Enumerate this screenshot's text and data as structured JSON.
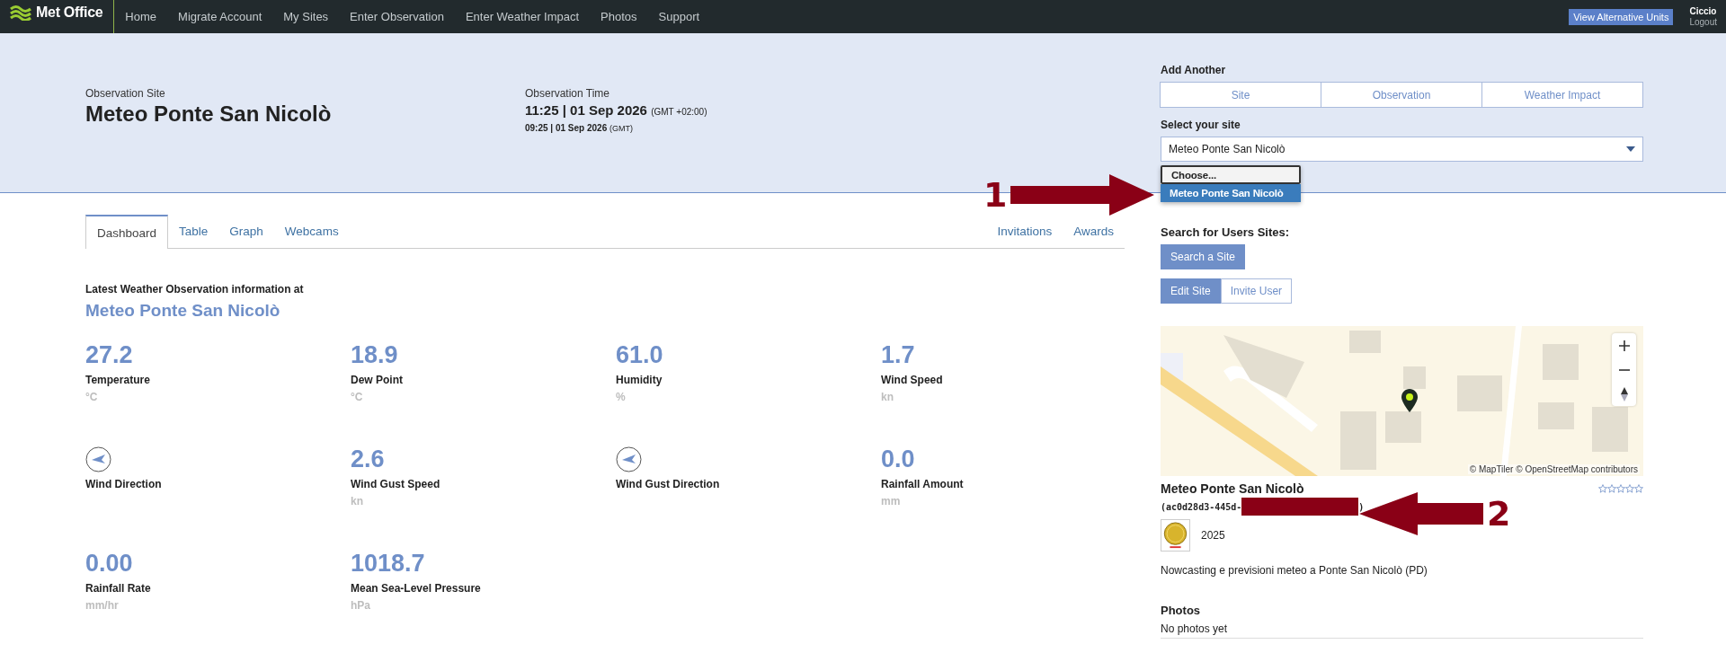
{
  "nav": {
    "logo": "Met Office",
    "links": [
      {
        "label": "Home"
      },
      {
        "label": "Migrate Account"
      },
      {
        "label": "My Sites"
      },
      {
        "label": "Enter Observation"
      },
      {
        "label": "Enter Weather Impact"
      },
      {
        "label": "Photos"
      },
      {
        "label": "Support"
      }
    ],
    "alt_units_button": "View Alternative Units",
    "user": "Ciccio",
    "logout": "Logout"
  },
  "header": {
    "site_label": "Observation Site",
    "site_name": "Meteo Ponte San Nicolò",
    "time_label": "Observation Time",
    "local_time": "11:25 | 01 Sep 2026",
    "local_zone": "(GMT +02:00)",
    "gmt_time": "09:25 | 01 Sep 2026",
    "gmt_zone": "(GMT)"
  },
  "tabs": [
    {
      "label": "Dashboard",
      "selected": true
    },
    {
      "label": "Table",
      "selected": false
    },
    {
      "label": "Graph",
      "selected": false
    },
    {
      "label": "Webcams",
      "selected": false
    }
  ],
  "side_tabs": [
    "Invitations",
    "Awards"
  ],
  "latest": {
    "heading": "Latest Weather Observation information at",
    "site": "Meteo Ponte San Nicolò"
  },
  "metrics": [
    {
      "kind": "value",
      "value": "27.2",
      "label": "Temperature",
      "unit": "°C"
    },
    {
      "kind": "value",
      "value": "18.9",
      "label": "Dew Point",
      "unit": "°C"
    },
    {
      "kind": "value",
      "value": "61.0",
      "label": "Humidity",
      "unit": "%"
    },
    {
      "kind": "value",
      "value": "1.7",
      "label": "Wind Speed",
      "unit": "kn"
    },
    {
      "kind": "direction",
      "label": "Wind Direction"
    },
    {
      "kind": "value",
      "value": "2.6",
      "label": "Wind Gust Speed",
      "unit": "kn"
    },
    {
      "kind": "direction",
      "label": "Wind Gust Direction"
    },
    {
      "kind": "value",
      "value": "0.0",
      "label": "Rainfall Amount",
      "unit": "mm"
    },
    {
      "kind": "value",
      "value": "0.00",
      "label": "Rainfall Rate",
      "unit": "mm/hr"
    },
    {
      "kind": "value",
      "value": "1018.7",
      "label": "Mean Sea-Level Pressure",
      "unit": "hPa"
    }
  ],
  "add_another": {
    "label": "Add Another",
    "buttons": [
      "Site",
      "Observation",
      "Weather Impact"
    ]
  },
  "site_select": {
    "label": "Select your site",
    "value": "Meteo Ponte San Nicolò",
    "options": [
      {
        "label": "Choose...",
        "selected": false
      },
      {
        "label": "Meteo Ponte San Nicolò",
        "selected": true
      }
    ]
  },
  "search": {
    "label": "Search for Users Sites:",
    "button": "Search a Site"
  },
  "site_actions": [
    {
      "label": "Edit Site",
      "selected": true
    },
    {
      "label": "Invite User",
      "selected": false
    }
  ],
  "map": {
    "kind": "picture",
    "attribution": "© MapTiler © OpenStreetMap contributors"
  },
  "site_card": {
    "name": "Meteo Ponte San Nicolò",
    "id_prefix": "(ac0d28d3-445d-",
    "id_suffix": ")",
    "stars": 0,
    "award_year": "2025",
    "description": "Nowcasting e previsioni meteo a Ponte San Nicolò (PD)"
  },
  "photos": {
    "heading": "Photos",
    "empty": "No photos yet"
  },
  "annotations": [
    {
      "number": "1"
    },
    {
      "number": "2"
    }
  ]
}
